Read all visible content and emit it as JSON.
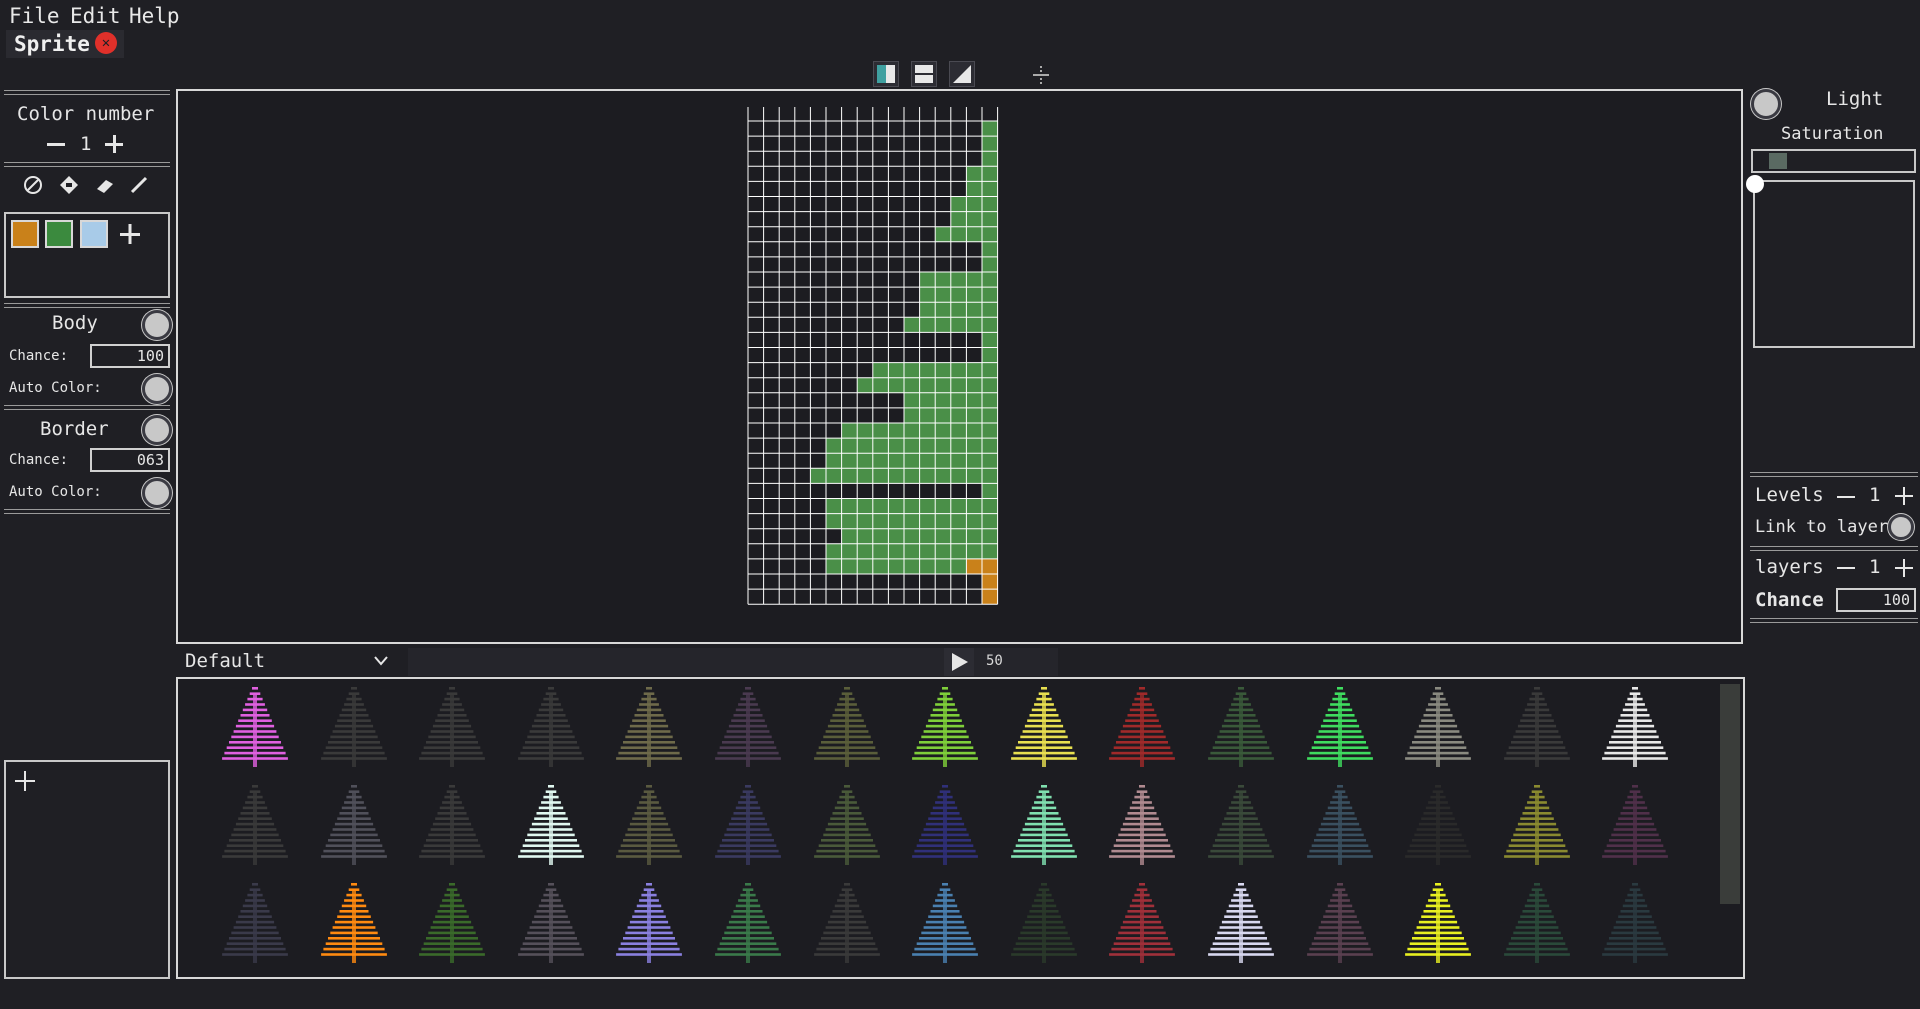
{
  "menu": {
    "file": "File",
    "edit": "Edit",
    "help": "Help"
  },
  "tab": {
    "label": "Sprite",
    "close_icon": "close-icon"
  },
  "mirror_tools": [
    "mirror-vertical-icon",
    "mirror-horizontal-icon",
    "mirror-diagonal-icon",
    "center-crosshair-icon"
  ],
  "left": {
    "color_number_label": "Color number",
    "color_number_value": "1",
    "tools": [
      "no-symbol-icon",
      "fill-bucket-icon",
      "eraser-icon",
      "pencil-icon"
    ],
    "palette": [
      "#c9811a",
      "#3b8a3e",
      "#a8cbe8"
    ],
    "body": {
      "title": "Body",
      "chance_label": "Chance:",
      "chance_value": "100",
      "auto_color_label": "Auto Color:"
    },
    "border": {
      "title": "Border",
      "chance_label": "Chance:",
      "chance_value": "063",
      "auto_color_label": "Auto Color:"
    }
  },
  "right": {
    "light_label": "Light",
    "saturation_label": "Saturation",
    "levels_label": "Levels",
    "levels_value": "1",
    "link_label": "Link to layer",
    "layers_label": "layers",
    "layers_value": "1",
    "chance_label": "Chance",
    "chance_value": "100"
  },
  "bottom": {
    "preset": "Default",
    "speed": "50"
  },
  "colors": {
    "grid_green": "#4a8f48",
    "grid_orange": "#c9811a",
    "grid_line": "#ffffff"
  },
  "sprite_tints": [
    [
      "#e060e0",
      "#3a3a3a",
      "#3a3a3a",
      "#3a3a3a",
      "#6e6a4a",
      "#4a3a50",
      "#5a5e3a",
      "#7fcf3a",
      "#e8e050",
      "#a02a2a",
      "#3a5a3a",
      "#3fdc5f",
      "#8a8a80",
      "#3a3a3a",
      "#e8e8e8"
    ],
    [
      "#3a3a3a",
      "#50505a",
      "#3a3a3a",
      "#e0f8f0",
      "#5a5a40",
      "#3a3a60",
      "#4a5a3a",
      "#30307a",
      "#80e0b0",
      "#b08a90",
      "#3a4a3a",
      "#3a5060",
      "#2a2a2a",
      "#8a8a30",
      "#50304a"
    ],
    [
      "#3a3a4a",
      "#ff8a10",
      "#3a6a2a",
      "#55505a",
      "#8a80e0",
      "#3a7a4a",
      "#3a3a3a",
      "#4a80b0",
      "#2a3a2a",
      "#a0303a",
      "#d8d8f0",
      "#5a4050",
      "#e8f020",
      "#2a4a3a",
      "#2a3a40"
    ]
  ]
}
